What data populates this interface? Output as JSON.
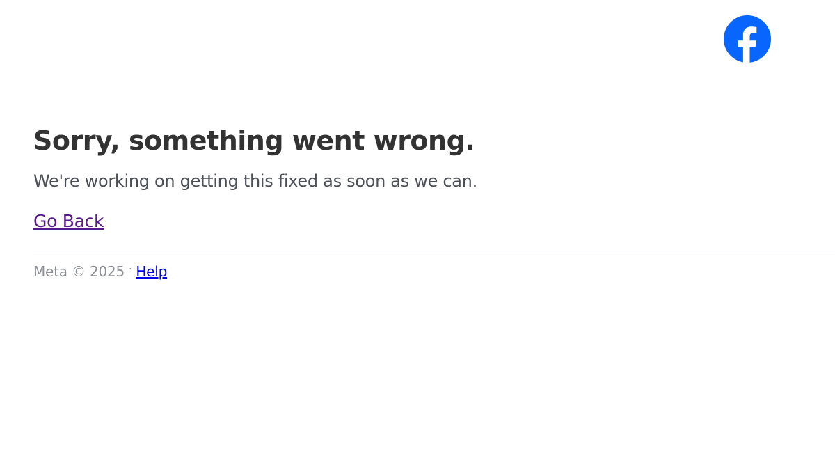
{
  "brand": {
    "logo_icon": "facebook-f-icon",
    "logo_color": "#0866ff"
  },
  "error": {
    "title": "Sorry, something went wrong.",
    "message": "We're working on getting this fixed as soon as we can.",
    "back_link": "Go Back"
  },
  "footer": {
    "copyright": "Meta © 2025",
    "separator": "·",
    "help_link": "Help"
  },
  "colors": {
    "title": "#333333",
    "visited_link": "#551a8b",
    "link": "#0000ee",
    "muted": "#8a8d91"
  }
}
